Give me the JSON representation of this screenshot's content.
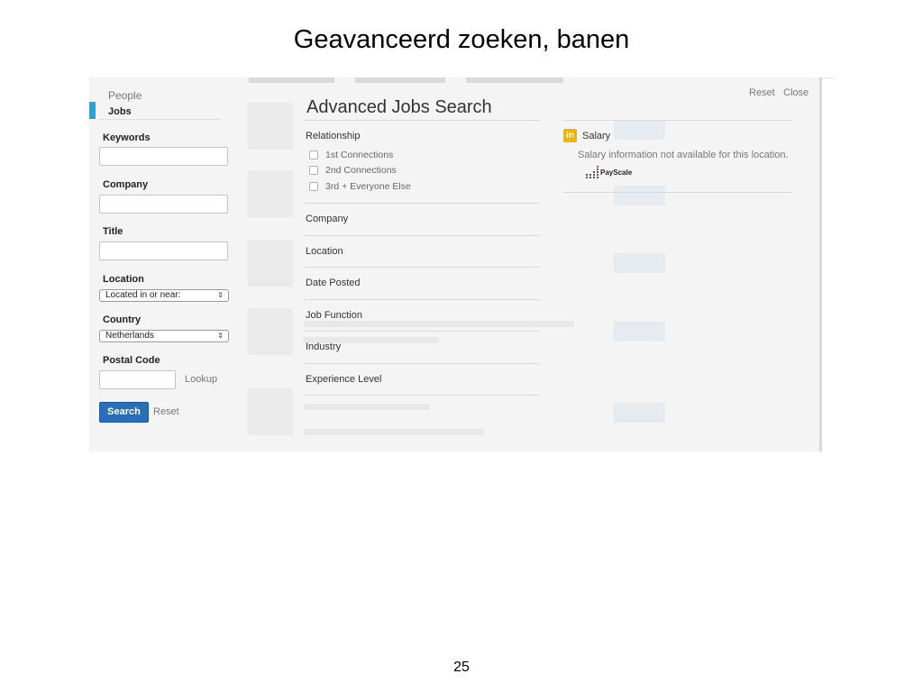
{
  "slide": {
    "title": "Geavanceerd zoeken, banen",
    "page_number": "25"
  },
  "sidebar": {
    "nav": {
      "people": "People",
      "jobs": "Jobs"
    },
    "fields": {
      "keywords": "Keywords",
      "company": "Company",
      "title": "Title",
      "location": "Location",
      "country": "Country",
      "postal_code": "Postal Code"
    },
    "location_select": "Located in or near:",
    "country_select": "Netherlands",
    "lookup": "Lookup",
    "search_button": "Search",
    "reset": "Reset"
  },
  "panel": {
    "title": "Advanced Jobs Search",
    "relationship": {
      "label": "Relationship",
      "options": [
        "1st Connections",
        "2nd Connections",
        "3rd + Everyone Else"
      ]
    },
    "sections": [
      "Company",
      "Location",
      "Date Posted",
      "Job Function",
      "Industry",
      "Experience Level"
    ]
  },
  "right": {
    "reset": "Reset",
    "close": "Close",
    "in_badge": "in",
    "salary_label": "Salary",
    "salary_message": "Salary information not available for this location.",
    "payscale": "PayScale"
  },
  "colors": {
    "accent_blue": "#2a6ebb",
    "nav_marker": "#1fa8e0",
    "in_badge": "#f0b400"
  }
}
